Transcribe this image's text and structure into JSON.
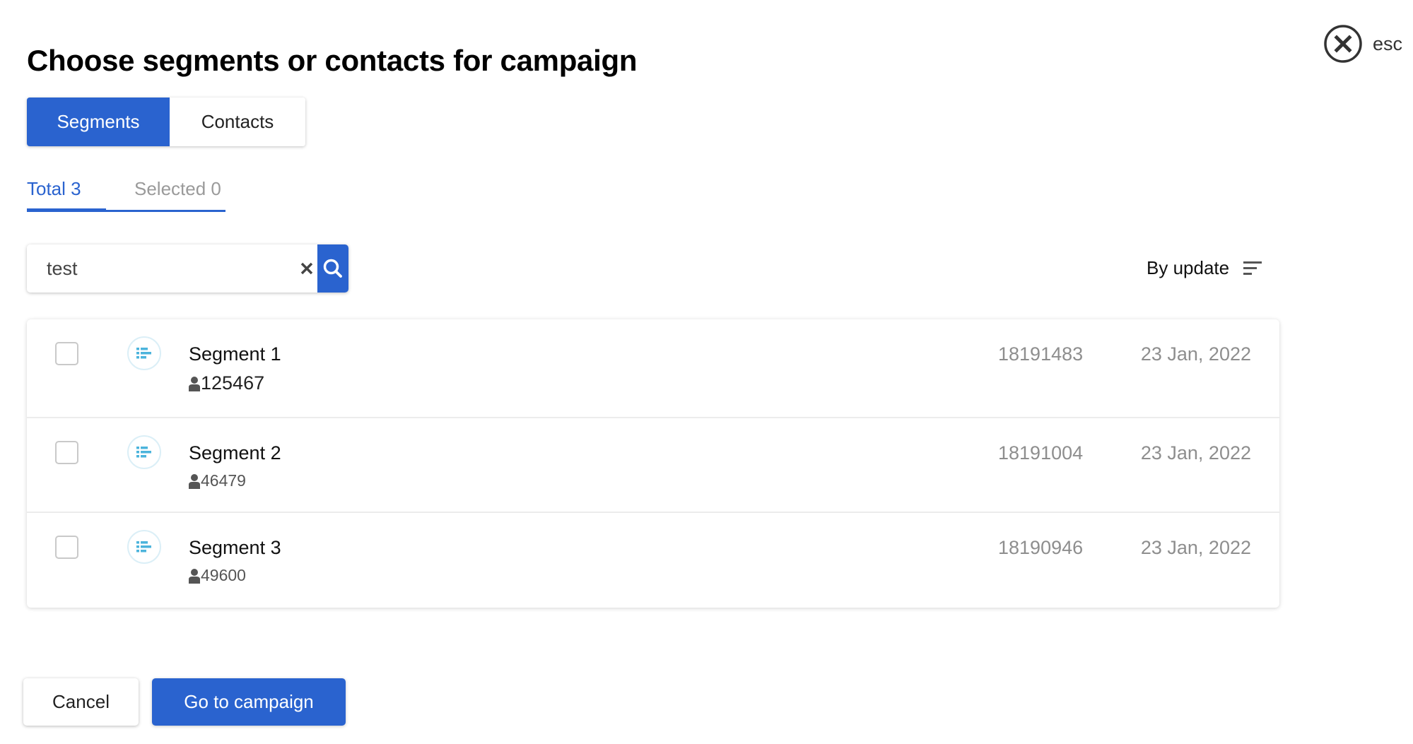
{
  "dialog": {
    "title": "Choose segments or contacts for campaign",
    "close_label": "esc"
  },
  "toggle": {
    "segments_label": "Segments",
    "contacts_label": "Contacts",
    "active": "Segments"
  },
  "sub_tabs": {
    "total_label": "Total 3",
    "selected_label": "Selected 0",
    "active": "Total"
  },
  "search": {
    "value": "test",
    "clear_icon": "close-icon",
    "search_icon": "search-icon"
  },
  "sort": {
    "label": "By update",
    "icon": "sort-lines-icon"
  },
  "segments": [
    {
      "name": "Segment 1",
      "count": "125467",
      "id": "18191483",
      "date": "23 Jan, 2022",
      "checked": false
    },
    {
      "name": "Segment 2",
      "count": "46479",
      "id": "18191004",
      "date": "23 Jan, 2022",
      "checked": false
    },
    {
      "name": "Segment 3",
      "count": "49600",
      "id": "18190946",
      "date": "23 Jan, 2022",
      "checked": false
    }
  ],
  "footer": {
    "cancel_label": "Cancel",
    "go_label": "Go to campaign"
  },
  "colors": {
    "accent": "#2a63cf",
    "segment_icon": "#4cb4dc",
    "muted_text": "#8e8e8e"
  }
}
